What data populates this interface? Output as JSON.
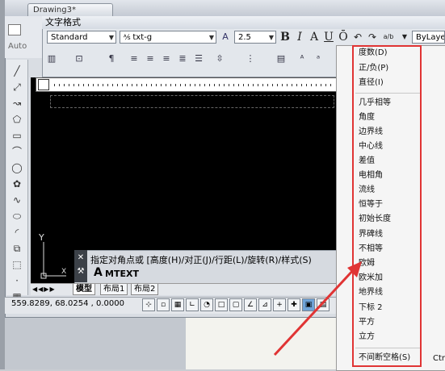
{
  "window": {
    "drawing_tab": "Drawing3*",
    "auto_label": "Auto"
  },
  "text_format": {
    "title": "文字格式",
    "style_value": "Standard",
    "font_value": "txt-g",
    "height_value": "2.5",
    "color_value": "ByLayer",
    "bold": "B",
    "italic": "I",
    "strike": "A",
    "underline": "U",
    "overline": "Ō",
    "undo": "↶",
    "redo": "↷",
    "stack": "a/b"
  },
  "command": {
    "prompt_text": "指定对角点或 [高度(H)/对正(J)/行距(L)/旋转(R)/样式(S)",
    "input_text": "MTEXT",
    "prompt_icon": "A"
  },
  "layout_tabs": [
    "模型",
    "布局1",
    "布局2"
  ],
  "status": {
    "coordinates": "559.8289, 68.0254 , 0.0000"
  },
  "symbol_menu": {
    "items": [
      "度数(D)",
      "正/负(P)",
      "直径(I)",
      "几乎相等",
      "角度",
      "边界线",
      "中心线",
      "差值",
      "电相角",
      "流线",
      "恒等于",
      "初始长度",
      "界碑线",
      "不相等",
      "欧姆",
      "欧米加",
      "地界线",
      "下标 2",
      "平方",
      "立方",
      "不间断空格(S)"
    ],
    "trailing_label": "Ctrl",
    "highlight_color": "#e03434"
  },
  "axis": {
    "y_label": "Y",
    "x_label": "X"
  }
}
